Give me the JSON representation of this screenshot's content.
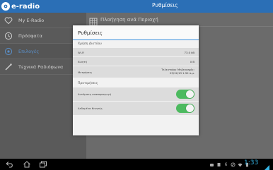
{
  "app": {
    "logo_text": "e-radio",
    "title": "Ρυθμίσεις"
  },
  "sidebar": {
    "items": [
      {
        "label": "My E-Radio",
        "icon": "heart-icon",
        "active": false
      },
      {
        "label": "Πρόσφατα",
        "icon": "clock-icon",
        "active": false
      },
      {
        "label": "Επιλογές",
        "icon": "settings-icon",
        "active": true
      },
      {
        "label": "Τεχνικά Ραδιόφωνα",
        "icon": "wand-icon",
        "active": false
      }
    ]
  },
  "main": {
    "row_label": "Πλοήγηση ανά Περιοχή",
    "row_icon": "grid-icon"
  },
  "dialog": {
    "title": "Ρυθμίσεις",
    "usage_section": "Χρήση Δικτύου",
    "wifi_label": "Wi-Fi",
    "wifi_value": "73.0 kB",
    "mobile_label": "Κινητή",
    "mobile_value": "0 B",
    "measured_label": "Μετρήσεις",
    "measured_value_line1": "Τελευταίος Μηδενισμός:",
    "measured_value_line2": "23/12/13 1:52 π.μ.",
    "prefs_section": "Προτιμήσεις",
    "autoplay_label": "Αυτόματη αναπαραγωγή",
    "autoplay_on": true,
    "mobile_data_label": "Δεδομένα Κινητής",
    "mobile_data_on": true
  },
  "statusbar": {
    "time": "1:33",
    "lte": "6"
  },
  "colors": {
    "brand": "#2b6fb6",
    "switch_on": "#4cba5f",
    "accent": "#3a8fdc",
    "clock": "#36b5e5"
  }
}
